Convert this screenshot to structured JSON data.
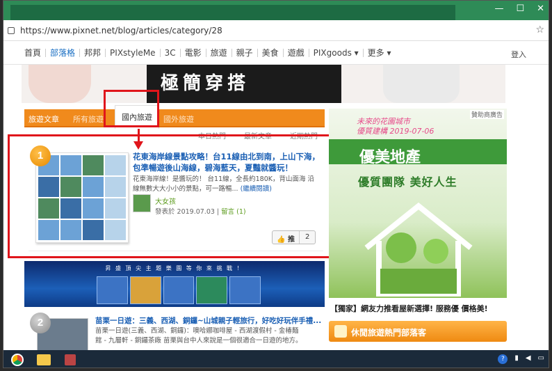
{
  "browser": {
    "url": "https://www.pixnet.net/blog/articles/category/28",
    "window_controls": [
      "—",
      "☐",
      "✕"
    ]
  },
  "nav": {
    "items": [
      "首頁",
      "部落格",
      "邦邦",
      "PIXstyleMe",
      "3C",
      "電影",
      "旅遊",
      "親子",
      "美食",
      "遊戲",
      "PIXgoods ▾",
      "更多 ▾"
    ],
    "active_index": 1,
    "login": "登入"
  },
  "banner": {
    "title": "極簡穿搭"
  },
  "categories": {
    "label": "旅遊文章",
    "prev": "所有旅遊",
    "active": "國內旅遊",
    "next": "國外旅遊"
  },
  "sorts": [
    "本日熱門",
    "最新文章",
    "近期熱門"
  ],
  "article1": {
    "rank": "1",
    "title": "花東海岸線景點攻略！台11線由北到南，上山下海，包準暢遊後山海線，碧海藍天，夏豔就醬玩！",
    "excerpt": "花東海岸線！是醬玩的！ 台11線，全長約180K，背山面海 沿線無數大大小小的景點，可一路暢...",
    "more": "(繼續閱讀)",
    "author": "大女孩",
    "posted": "發表於 2019.07.03 | ",
    "comments": "留言 (1)",
    "push_label": "推",
    "push_count": "2"
  },
  "promo": {
    "caption": "昇 盛 頂 尖 主 題 樂 園 等 你 來 挑 戰 ！"
  },
  "article2": {
    "rank": "2",
    "title": "苗栗一日遊：三義、西湖、銅鑼~山城親子輕旅行，好吃好玩伴手禮...",
    "excerpt": "苗栗一日遊(三義、西湖、銅鑼)：噢哈娜咖啡屋 - 西湖渡假村 - 金椿麵館 - 九層軒 - 銅鑼茶廠 苗栗與台中人來說是一個很適合一日遊的地方。"
  },
  "ad": {
    "tag": "贊助商廣告",
    "slogan_1": "未來的花園城市",
    "slogan_2": "優質建構 2019-07-06",
    "logo": "優美地產",
    "sub": "優質團隊 美好人生",
    "caption": "【獨家】網友力推看屋新選擇! 服務優 價格美!"
  },
  "hot": {
    "label": "休閒旅遊熱門部落客"
  },
  "colors": {
    "accent_orange": "#f08a1c",
    "link_blue": "#1a5fb4",
    "annotation_red": "#e0151b"
  }
}
